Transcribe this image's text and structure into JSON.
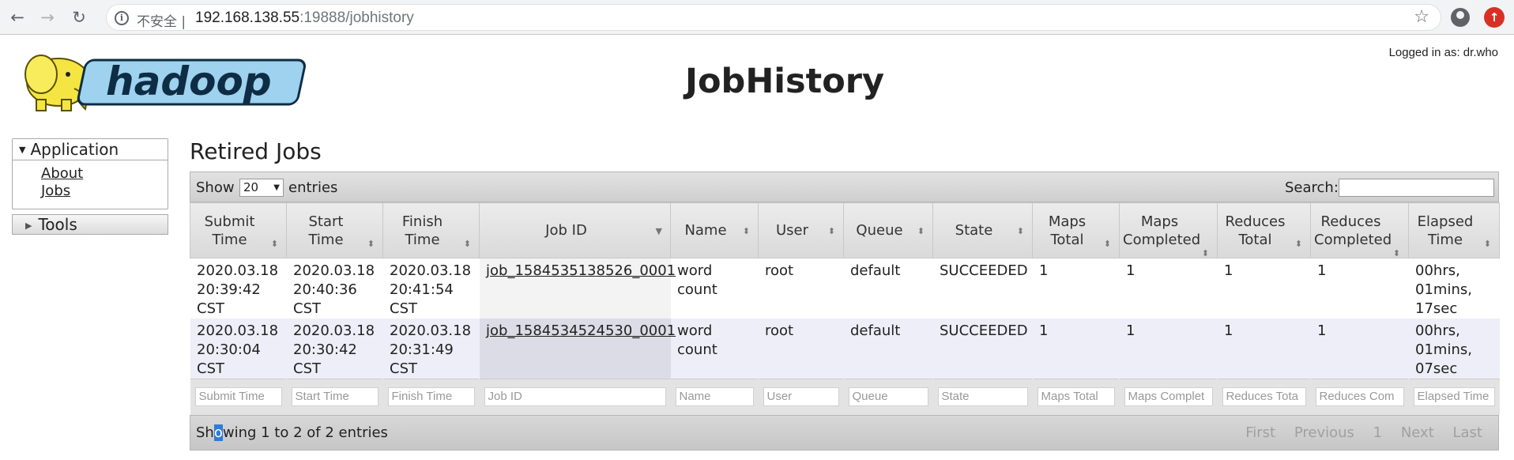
{
  "browser": {
    "back_glyph": "←",
    "forward_glyph": "→",
    "reload_glyph": "↻",
    "info_glyph": "i",
    "security_label": "不安全 |",
    "url_host": "192.168.138.55",
    "url_rest": ":19888/jobhistory",
    "star_glyph": "☆",
    "ext_glyph": "↑"
  },
  "header": {
    "logged_in": "Logged in as: dr.who",
    "title": "JobHistory",
    "logo_text": "hadoop"
  },
  "sidebar": {
    "application": {
      "label": "Application",
      "tri": "▼"
    },
    "links": [
      {
        "label": "About"
      },
      {
        "label": "Jobs"
      }
    ],
    "tools": {
      "label": "Tools",
      "tri": "▶"
    }
  },
  "main": {
    "section_title": "Retired Jobs",
    "show_label": "Show",
    "page_size": "20",
    "entries_label": "entries",
    "search_label": "Search:",
    "columns": [
      {
        "label": "Submit Time"
      },
      {
        "label": "Start Time"
      },
      {
        "label": "Finish Time"
      },
      {
        "label": "Job ID"
      },
      {
        "label": "Name"
      },
      {
        "label": "User"
      },
      {
        "label": "Queue"
      },
      {
        "label": "State"
      },
      {
        "label": "Maps Total"
      },
      {
        "label": "Maps Completed"
      },
      {
        "label": "Reduces Total"
      },
      {
        "label": "Reduces Completed"
      },
      {
        "label": "Elapsed Time"
      }
    ],
    "rows": [
      {
        "submit": "2020.03.18 20:39:42 CST",
        "start": "2020.03.18 20:40:36 CST",
        "finish": "2020.03.18 20:41:54 CST",
        "job_id": "job_1584535138526_0001",
        "name": "word count",
        "user": "root",
        "queue": "default",
        "state": "SUCCEEDED",
        "maps_total": "1",
        "maps_completed": "1",
        "reduces_total": "1",
        "reduces_completed": "1",
        "elapsed": "00hrs, 01mins, 17sec"
      },
      {
        "submit": "2020.03.18 20:30:04 CST",
        "start": "2020.03.18 20:30:42 CST",
        "finish": "2020.03.18 20:31:49 CST",
        "job_id": "job_1584534524530_0001",
        "name": "word count",
        "user": "root",
        "queue": "default",
        "state": "SUCCEEDED",
        "maps_total": "1",
        "maps_completed": "1",
        "reduces_total": "1",
        "reduces_completed": "1",
        "elapsed": "00hrs, 01mins, 07sec"
      }
    ],
    "filters": [
      "Submit Time",
      "Start Time",
      "Finish Time",
      "Job ID",
      "Name",
      "User",
      "Queue",
      "State",
      "Maps Total",
      "Maps Complet",
      "Reduces Tota",
      "Reduces Com",
      "Elapsed Time"
    ],
    "info_pre": "Sh",
    "info_hl": "o",
    "info_post": "wing 1 to 2 of 2 entries",
    "pager": {
      "first": "First",
      "previous": "Previous",
      "page": "1",
      "next": "Next",
      "last": "Last"
    }
  }
}
